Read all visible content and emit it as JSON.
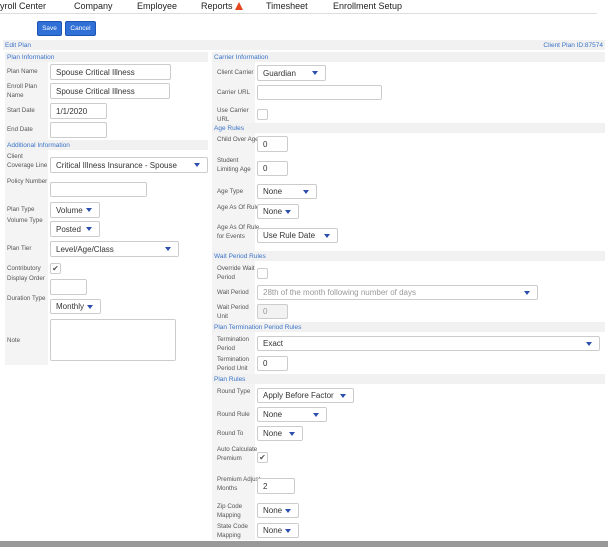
{
  "nav": {
    "items": [
      "yroll Center",
      "Company",
      "Employee",
      "Reports",
      "Timesheet",
      "Enrollment Setup"
    ],
    "reports_icon": "warning-icon"
  },
  "toolbar": {
    "save_label": "Save",
    "cancel_label": "Cancel"
  },
  "header": {
    "title": "Edit Plan",
    "client_plan_id": "Client Plan ID:87574"
  },
  "sections": {
    "plan_information": "Plan Information",
    "additional_information": "Additional Information",
    "carrier_information": "Carrier Information",
    "age_rules": "Age Rules",
    "wait_period_rules": "Wait Period Rules",
    "plan_termination_period_rules": "Plan Termination Period Rules",
    "plan_rules": "Plan Rules"
  },
  "left_fields": [
    {
      "label": "Plan Name",
      "type": "text",
      "value": "Spouse Critical Illness"
    },
    {
      "label": "Enroll Plan Name",
      "type": "text",
      "value": "Spouse Critical Illness"
    },
    {
      "label": "Start Date",
      "type": "text",
      "value": "1/1/2020"
    },
    {
      "label": "End Date",
      "type": "text",
      "value": ""
    },
    {
      "label": "Client Coverage Line",
      "type": "select",
      "value": "Critical Illness Insurance - Spouse"
    },
    {
      "label": "Policy Number",
      "type": "text",
      "value": ""
    },
    {
      "label": "Plan Type",
      "type": "select",
      "value": "Volume"
    },
    {
      "label": "Volume Type",
      "type": "select",
      "value": "Posted"
    },
    {
      "label": "Plan Tier",
      "type": "select",
      "value": "Level/Age/Class"
    },
    {
      "label": "Contributory",
      "type": "checkbox",
      "checked": true
    },
    {
      "label": "Display Order",
      "type": "text",
      "value": ""
    },
    {
      "label": "Duration Type",
      "type": "select",
      "value": "Monthly"
    },
    {
      "label": "Note",
      "type": "textarea",
      "value": ""
    }
  ],
  "right_fields": [
    {
      "label": "Client Carrier",
      "type": "select",
      "value": "Guardian"
    },
    {
      "label": "Carrier URL",
      "type": "text",
      "value": ""
    },
    {
      "label": "Use Carrier URL",
      "type": "checkbox",
      "checked": false
    },
    {
      "label": "Child Over Age",
      "type": "text",
      "value": "0"
    },
    {
      "label": "Student Limiting Age",
      "type": "text",
      "value": "0"
    },
    {
      "label": "Age Type",
      "type": "select",
      "value": "None"
    },
    {
      "label": "Age As Of Rule",
      "type": "select",
      "value": "None"
    },
    {
      "label": "Age As Of Rule for Events",
      "type": "select",
      "value": "Use Rule Date"
    },
    {
      "label": "Override Wait Period",
      "type": "checkbox",
      "checked": false
    },
    {
      "label": "Wait Period",
      "type": "select",
      "value": "28th of the month following number of days",
      "disabled": true
    },
    {
      "label": "Wait Period Unit",
      "type": "text",
      "value": "0",
      "disabled": true
    },
    {
      "label": "Termination Period",
      "type": "select",
      "value": "Exact"
    },
    {
      "label": "Termination Period Unit",
      "type": "text",
      "value": "0"
    },
    {
      "label": "Round Type",
      "type": "select",
      "value": "Apply Before Factor"
    },
    {
      "label": "Round Rule",
      "type": "select",
      "value": "None"
    },
    {
      "label": "Round To",
      "type": "select",
      "value": "None"
    },
    {
      "label": "Auto Calculate Premium",
      "type": "checkbox",
      "checked": true
    },
    {
      "label": "Premium Adjust Months",
      "type": "text",
      "value": "2"
    },
    {
      "label": "Zip Code Mapping",
      "type": "select",
      "value": "None"
    },
    {
      "label": "State Code Mapping",
      "type": "select",
      "value": "None"
    }
  ],
  "colors": {
    "accent": "#2f6fd6",
    "section_text": "#3a73c8",
    "warning": "#e4461f"
  }
}
